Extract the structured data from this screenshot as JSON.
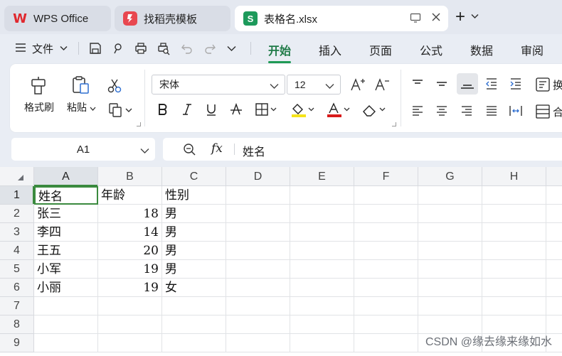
{
  "tabs": [
    {
      "label": "WPS Office",
      "icon": "wps-logo-icon"
    },
    {
      "label": "找稻壳模板",
      "icon": "template-icon"
    },
    {
      "label": "表格名.xlsx",
      "icon": "spreadsheet-icon",
      "badge": "S"
    }
  ],
  "menu": {
    "file_label": "文件",
    "tabs": [
      "开始",
      "插入",
      "页面",
      "公式",
      "数据",
      "审阅"
    ],
    "active_tab": "开始"
  },
  "ribbon": {
    "format_painter": "格式刷",
    "paste": "粘贴",
    "font_name": "宋体",
    "font_size": "12",
    "wrap_partial": "换",
    "merge_partial": "合"
  },
  "formula_bar": {
    "name_box": "A1",
    "fx_label": "fx",
    "content": "姓名"
  },
  "grid": {
    "columns": [
      "A",
      "B",
      "C",
      "D",
      "E",
      "F",
      "G",
      "H"
    ],
    "rows": [
      "1",
      "2",
      "3",
      "4",
      "5",
      "6",
      "7",
      "8",
      "9"
    ],
    "cells": [
      [
        "姓名",
        "年龄",
        "性别"
      ],
      [
        "张三",
        "18",
        "男"
      ],
      [
        "李四",
        "14",
        "男"
      ],
      [
        "王五",
        "20",
        "男"
      ],
      [
        "小军",
        "19",
        "男"
      ],
      [
        "小丽",
        "19",
        "女"
      ]
    ]
  },
  "watermark": "CSDN @缘去缘来缘如水",
  "colors": {
    "accent_green": "#1f9a55",
    "selection_green": "#3a8a3e",
    "wps_red": "#e0282e"
  }
}
